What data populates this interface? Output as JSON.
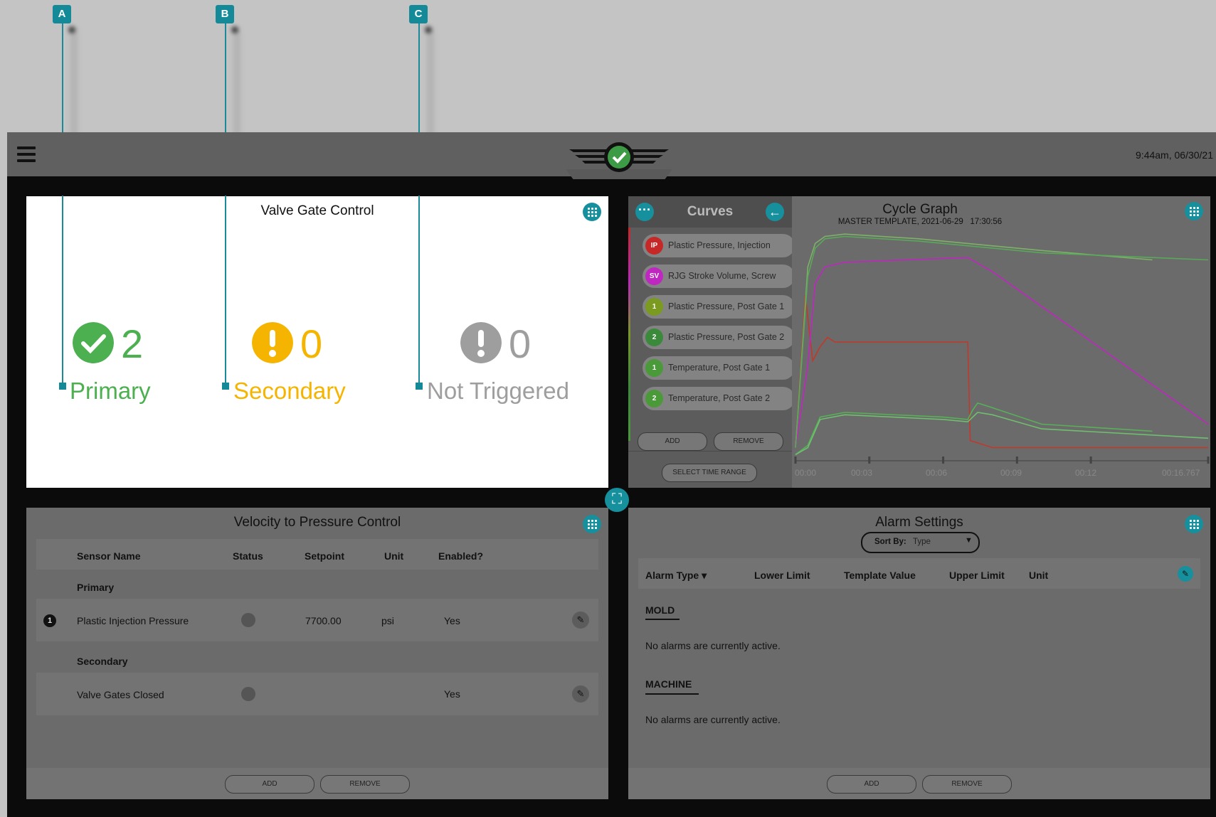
{
  "callouts": [
    "A",
    "B",
    "C"
  ],
  "header": {
    "clock": "9:44am, 06/30/21"
  },
  "valve_gate": {
    "title": "Valve Gate Control",
    "primary": {
      "count": "2",
      "label": "Primary",
      "color": "#4caf50"
    },
    "secondary": {
      "count": "0",
      "label": "Secondary",
      "color": "#f5b400"
    },
    "not_triggered": {
      "count": "0",
      "label": "Not Triggered",
      "color": "#9e9e9e"
    }
  },
  "curves": {
    "title": "Curves",
    "items": [
      {
        "badge": "IP",
        "label": "Plastic Pressure, Injection",
        "color": "#c62828"
      },
      {
        "badge": "SV",
        "label": "RJG Stroke Volume, Screw",
        "color": "#c026c0"
      },
      {
        "badge": "1",
        "label": "Plastic Pressure, Post Gate 1",
        "color": "#7a9a20"
      },
      {
        "badge": "2",
        "label": "Plastic Pressure, Post Gate 2",
        "color": "#3b8a3b"
      },
      {
        "badge": "1",
        "label": "Temperature, Post Gate 1",
        "color": "#4a9a3a"
      },
      {
        "badge": "2",
        "label": "Temperature, Post Gate 2",
        "color": "#4a9a3a"
      }
    ],
    "add_label": "ADD",
    "remove_label": "REMOVE",
    "select_range_label": "SELECT TIME RANGE"
  },
  "cycle_graph": {
    "title": "Cycle Graph",
    "subtitle": "MASTER TEMPLATE, 2021-06-29   17:30:56",
    "x_ticks": [
      "00:00",
      "00:03",
      "00:06",
      "00:09",
      "00:12",
      "00:16.767"
    ]
  },
  "chart_data": {
    "type": "line",
    "title": "Cycle Graph",
    "xlabel": "",
    "ylabel": "",
    "xlim": [
      0,
      16.767
    ],
    "ylim": [
      0,
      100
    ],
    "series": [
      {
        "name": "Plastic Pressure, Injection",
        "color": "#c0392b",
        "x": [
          0,
          0.4,
          0.7,
          1.0,
          1.3,
          1.6,
          2.0,
          7.0,
          7.1,
          7.4,
          8.0,
          16.767
        ],
        "y": [
          5,
          70,
          42,
          48,
          52,
          50,
          50,
          50,
          8,
          7,
          5,
          5
        ]
      },
      {
        "name": "RJG Stroke Volume, Screw",
        "color": "#c026c0",
        "x": [
          0,
          0.5,
          0.8,
          1.2,
          2.0,
          7.0,
          8.0,
          16.767
        ],
        "y": [
          5,
          40,
          75,
          82,
          84,
          86,
          80,
          15
        ]
      },
      {
        "name": "Plastic Pressure, Post Gate 1",
        "color": "#7fb069",
        "x": [
          0,
          0.5,
          0.8,
          1.2,
          2.0,
          5.0,
          10.0,
          14.5
        ],
        "y": [
          5,
          82,
          92,
          95,
          96,
          94,
          89,
          85
        ]
      },
      {
        "name": "Plastic Pressure, Post Gate 2",
        "color": "#5aa85a",
        "x": [
          0,
          0.5,
          0.8,
          1.2,
          2.0,
          5.0,
          10.0,
          16.767
        ],
        "y": [
          5,
          78,
          90,
          94,
          95,
          93,
          88,
          85
        ]
      },
      {
        "name": "Temperature, Post Gate 1",
        "color": "#58b058",
        "x": [
          0,
          0.5,
          1.0,
          2.0,
          6.0,
          7.0,
          7.2,
          7.4,
          8.0,
          10.0,
          14.5
        ],
        "y": [
          2,
          6,
          18,
          20,
          18,
          17,
          21,
          24,
          22,
          15,
          12
        ]
      },
      {
        "name": "Temperature, Post Gate 2",
        "color": "#6fbf6f",
        "x": [
          0,
          0.5,
          1.0,
          2.0,
          6.0,
          7.0,
          7.2,
          7.4,
          8.0,
          10.0,
          16.767
        ],
        "y": [
          2,
          5,
          17,
          19,
          17,
          16,
          18,
          20,
          19,
          13,
          9
        ]
      }
    ]
  },
  "vp_control": {
    "title": "Velocity to Pressure Control",
    "headers": [
      "Sensor Name",
      "Status",
      "Setpoint",
      "Unit",
      "Enabled?"
    ],
    "primary_label": "Primary",
    "secondary_label": "Secondary",
    "rows": [
      {
        "index": "1",
        "name": "Plastic Injection Pressure",
        "setpoint": "7700.00",
        "unit": "psi",
        "enabled": "Yes"
      },
      {
        "index": "",
        "name": "Valve Gates Closed",
        "setpoint": "",
        "unit": "",
        "enabled": "Yes"
      }
    ],
    "add_label": "ADD",
    "remove_label": "REMOVE"
  },
  "alarm_settings": {
    "title": "Alarm Settings",
    "sort_label": "Sort By:",
    "sort_value": "Type",
    "headers": [
      "Alarm Type",
      "Lower Limit",
      "Template Value",
      "Upper Limit",
      "Unit"
    ],
    "mold_label": "MOLD",
    "mold_text": "No alarms are currently active.",
    "machine_label": "MACHINE",
    "machine_text": "No alarms are currently active.",
    "add_label": "ADD",
    "remove_label": "REMOVE"
  }
}
